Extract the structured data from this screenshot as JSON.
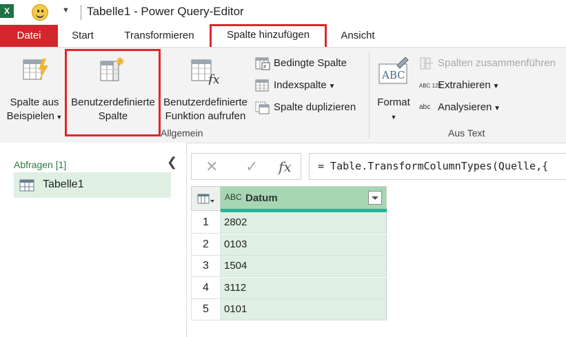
{
  "window": {
    "app_badge": "X",
    "title": "Tabelle1 - Power Query-Editor"
  },
  "tabs": [
    {
      "label": "Datei"
    },
    {
      "label": "Start"
    },
    {
      "label": "Transformieren"
    },
    {
      "label": "Spalte hinzufügen"
    },
    {
      "label": "Ansicht"
    }
  ],
  "ribbon": {
    "general": {
      "group_label": "Allgemein",
      "column_from_examples": {
        "line1": "Spalte aus",
        "line2": "Beispielen"
      },
      "custom_column": {
        "line1": "Benutzerdefinierte",
        "line2": "Spalte"
      },
      "invoke_custom_function": {
        "line1": "Benutzerdefinierte",
        "line2": "Funktion aufrufen"
      },
      "conditional_column": "Bedingte Spalte",
      "index_column": "Indexspalte",
      "duplicate_column": "Spalte duplizieren"
    },
    "from_text": {
      "group_label": "Aus Text",
      "format": "Format",
      "format_icon_text": "ABC",
      "merge_columns": "Spalten zusammenführen",
      "extract": "Extrahieren",
      "extract_icon_text": "ABC 123",
      "parse": "Analysieren",
      "parse_icon_text": "abc"
    }
  },
  "queries": {
    "header": "Abfragen [1]",
    "items": [
      {
        "label": "Tabelle1"
      }
    ]
  },
  "formula_bar": {
    "formula": "= Table.TransformColumnTypes(Quelle,{"
  },
  "grid": {
    "column": {
      "type_icon": "ABC",
      "name": "Datum"
    },
    "rows": [
      {
        "n": "1",
        "value": "2802"
      },
      {
        "n": "2",
        "value": "0103"
      },
      {
        "n": "3",
        "value": "1504"
      },
      {
        "n": "4",
        "value": "3112"
      },
      {
        "n": "5",
        "value": "0101"
      }
    ]
  },
  "colors": {
    "file_tab": "#d1262b",
    "highlight": "#e0262b",
    "query_selected": "#dff0e2",
    "column_header": "#a6d7b2",
    "column_accent": "#27b194"
  },
  "icons": [
    "excel-icon",
    "smiley-icon",
    "qat-dropdown-icon",
    "column-from-examples-icon",
    "custom-column-icon",
    "custom-function-icon",
    "conditional-column-icon",
    "index-column-icon",
    "duplicate-column-icon",
    "format-icon",
    "merge-columns-icon",
    "extract-icon",
    "parse-icon",
    "collapse-icon",
    "table-icon",
    "cancel-icon",
    "confirm-icon",
    "fx-icon",
    "grid-menu-icon",
    "column-type-icon",
    "column-filter-icon"
  ]
}
